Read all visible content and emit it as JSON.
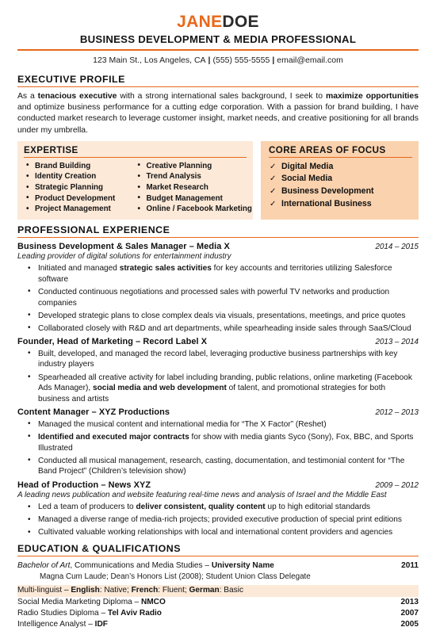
{
  "colors": {
    "accent_orange": "#E8681A",
    "expertise_box_bg": "#FCE9D8",
    "core_box_bg": "#FAD2AE",
    "text": "#141414"
  },
  "header": {
    "first_name": "JANE",
    "last_name": "DOE",
    "headline": "BUSINESS DEVELOPMENT & MEDIA PROFESSIONAL",
    "address": "123 Main St., Los Angeles, CA",
    "phone": "(555) 555-5555",
    "email": "email@email.com",
    "separator": "|"
  },
  "executive_profile": {
    "heading": "EXECUTIVE PROFILE",
    "text_1": "As a ",
    "bold_1": "tenacious executive",
    "text_2": " with a strong international sales background, I seek to ",
    "bold_2": "maximize opportunities",
    "text_3": " and optimize business performance for a cutting edge corporation. With a passion for brand building, I have conducted market research to leverage customer insight, market needs, and creative positioning for all brands under my umbrella."
  },
  "expertise": {
    "heading": "EXPERTISE",
    "column_left": [
      "Brand Building",
      "Identity Creation",
      "Strategic Planning",
      "Product Development",
      "Project Management"
    ],
    "column_right": [
      "Creative Planning",
      "Trend Analysis",
      "Market Research",
      "Budget Management",
      "Online / Facebook Marketing"
    ]
  },
  "core_areas": {
    "heading": "CORE AREAS OF FOCUS",
    "check_glyph": "✓",
    "items": [
      "Digital Media",
      "Social Media",
      "Business Development",
      "International Business"
    ]
  },
  "experience": {
    "heading": "PROFESSIONAL EXPERIENCE",
    "jobs": [
      {
        "title": "Business Development & Sales Manager – Media X",
        "dates": "2014 – 2015",
        "subtitle": "Leading provider of digital solutions for entertainment industry",
        "bullets": [
          {
            "pre": "Initiated and managed ",
            "bold": "strategic sales activities",
            "post": " for key accounts and territories utilizing Salesforce software"
          },
          {
            "pre": "Conducted continuous negotiations and processed sales with powerful TV networks and production companies",
            "bold": "",
            "post": ""
          },
          {
            "pre": "Developed strategic plans to close complex deals via visuals, presentations, meetings, and price quotes",
            "bold": "",
            "post": ""
          },
          {
            "pre": "Collaborated closely with R&D and art departments, while spearheading inside sales through SaaS/Cloud",
            "bold": "",
            "post": ""
          }
        ]
      },
      {
        "title": "Founder, Head of Marketing – Record Label X",
        "dates": "2013 – 2014",
        "subtitle": "",
        "bullets": [
          {
            "pre": "Built, developed, and managed the record label, leveraging productive business partnerships with key industry players",
            "bold": "",
            "post": ""
          },
          {
            "pre": "Spearheaded all creative activity for label including branding, public relations, online marketing (Facebook Ads Manager), ",
            "bold": "social media and web development",
            "post": " of talent, and promotional strategies for both business and artists"
          }
        ]
      },
      {
        "title": "Content Manager – XYZ Productions",
        "dates": "2012 – 2013",
        "subtitle": "",
        "bullets": [
          {
            "pre": "Managed the musical content and international media for “The X Factor” (Reshet)",
            "bold": "",
            "post": ""
          },
          {
            "pre": "",
            "bold": "Identified and executed major contracts",
            "post": " for show with media giants Syco (Sony), Fox, BBC, and Sports Illustrated"
          },
          {
            "pre": "Conducted all musical management, research, casting, documentation, and testimonial content for “The Band Project” (Children’s television show)",
            "bold": "",
            "post": ""
          }
        ]
      },
      {
        "title": "Head of Production – News XYZ",
        "dates": "2009 – 2012",
        "subtitle": "A leading news publication and website featuring real-time news and analysis of Israel and the Middle East",
        "bullets": [
          {
            "pre": "Led a team of producers to ",
            "bold": "deliver consistent, quality content",
            "post": " up to high editorial standards"
          },
          {
            "pre": "Managed a diverse range of media-rich projects; provided executive production of special print editions",
            "bold": "",
            "post": ""
          },
          {
            "pre": "Cultivated valuable working relationships with local and international content providers and agencies",
            "bold": "",
            "post": ""
          }
        ]
      }
    ]
  },
  "education": {
    "heading": "EDUCATION & QUALIFICATIONS",
    "degree_italic": "Bachelor of Art",
    "degree_rest": ", Communications and Media Studies – ",
    "degree_bold": "University Name",
    "degree_year": "2011",
    "honors": "Magna Cum Laude; Dean’s Honors List (2008); Student Union Class Delegate",
    "languages": {
      "prefix": "Multi-linguist – ",
      "lang1": "English",
      "lang1_level": ": Native; ",
      "lang2": "French",
      "lang2_level": ": Fluent; ",
      "lang3": "German",
      "lang3_level": ": Basic"
    },
    "certifications": [
      {
        "pre": "Social Media Marketing Diploma – ",
        "bold": "NMCO",
        "year": "2013"
      },
      {
        "pre": "Radio Studies Diploma – ",
        "bold": "Tel Aviv Radio",
        "year": "2007"
      },
      {
        "pre": "Intelligence Analyst – ",
        "bold": "IDF",
        "year": "2005"
      }
    ]
  }
}
